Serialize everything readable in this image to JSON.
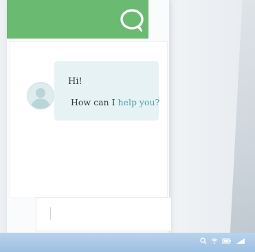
{
  "chat": {
    "messages": [
      {
        "line1": "Hi!",
        "line2_start": "How can I ",
        "line2_accent": "help you?"
      }
    ]
  },
  "colors": {
    "header": "#6aba72",
    "bubble": "#e6f2f4",
    "accent_text": "#4f9ea8",
    "taskbar": "#a8c8e6"
  },
  "icons": {
    "header": "chat-bubble-icon",
    "avatar": "user-avatar-icon",
    "tray": [
      "search-icon",
      "wifi-icon",
      "battery-icon",
      "signal-icon"
    ]
  }
}
